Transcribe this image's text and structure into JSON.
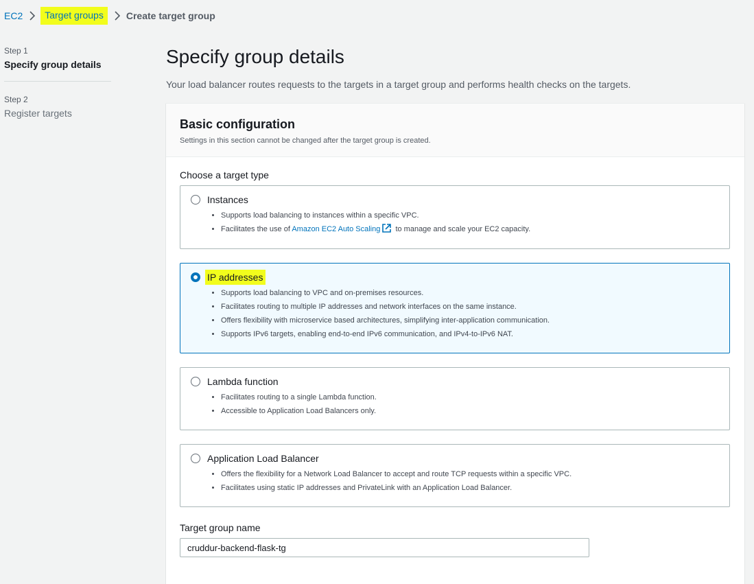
{
  "breadcrumb": {
    "items": [
      "EC2",
      "Target groups"
    ],
    "current": "Create target group"
  },
  "steps": [
    {
      "label": "Step 1",
      "title": "Specify group details"
    },
    {
      "label": "Step 2",
      "title": "Register targets"
    }
  ],
  "page": {
    "title": "Specify group details",
    "description": "Your load balancer routes requests to the targets in a target group and performs health checks on the targets."
  },
  "basic_config": {
    "title": "Basic configuration",
    "subtitle": "Settings in this section cannot be changed after the target group is created."
  },
  "target_type": {
    "label": "Choose a target type",
    "options": [
      {
        "title": "Instances",
        "bullets": [
          "Supports load balancing to instances within a specific VPC.",
          "Facilitates the use of"
        ],
        "link_text": "Amazon EC2 Auto Scaling",
        "link_suffix": "to manage and scale your EC2 capacity."
      },
      {
        "title": "IP addresses",
        "bullets": [
          "Supports load balancing to VPC and on-premises resources.",
          "Facilitates routing to multiple IP addresses and network interfaces on the same instance.",
          "Offers flexibility with microservice based architectures, simplifying inter-application communication.",
          "Supports IPv6 targets, enabling end-to-end IPv6 communication, and IPv4-to-IPv6 NAT."
        ]
      },
      {
        "title": "Lambda function",
        "bullets": [
          "Facilitates routing to a single Lambda function.",
          "Accessible to Application Load Balancers only."
        ]
      },
      {
        "title": "Application Load Balancer",
        "bullets": [
          "Offers the flexibility for a Network Load Balancer to accept and route TCP requests within a specific VPC.",
          "Facilitates using static IP addresses and PrivateLink with an Application Load Balancer."
        ]
      }
    ],
    "selected": "IP addresses"
  },
  "target_group_name": {
    "label": "Target group name",
    "value": "cruddur-backend-flask-tg"
  },
  "colors": {
    "link": "#0073bb",
    "highlight": "#f2fd1c",
    "selected_tile_bg": "#f1faff"
  }
}
